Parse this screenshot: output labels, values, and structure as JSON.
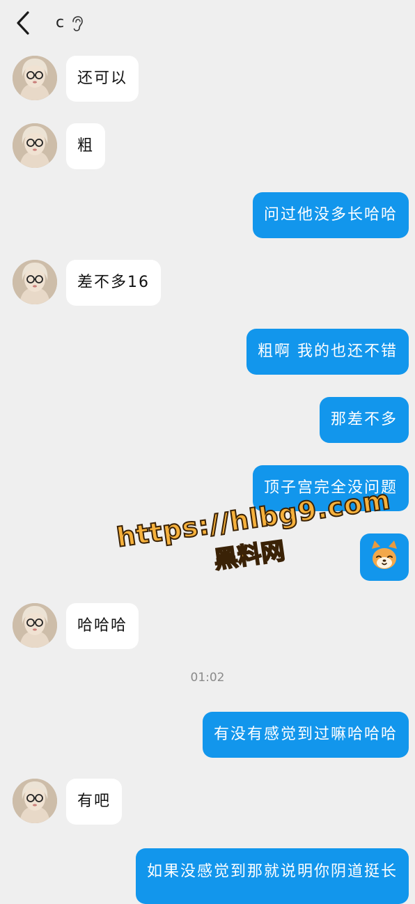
{
  "header": {
    "contact_name": "c",
    "back_icon": "chevron-left-icon",
    "ear_icon": "ear-icon"
  },
  "colors": {
    "background": "#efefef",
    "outgoing": "#1296ec",
    "incoming": "#ffffff"
  },
  "messages": [
    {
      "from": "them",
      "text": "还可以"
    },
    {
      "from": "them",
      "text": "粗"
    },
    {
      "from": "me",
      "text": "问过他没多长哈哈"
    },
    {
      "from": "them",
      "text": "差不多16"
    },
    {
      "from": "me",
      "text": "粗啊 我的也还不错"
    },
    {
      "from": "me",
      "text": "那差不多"
    },
    {
      "from": "me",
      "text": "顶子宫完全没问题"
    },
    {
      "from": "me",
      "sticker": "shiba-dog-emoji"
    },
    {
      "from": "them",
      "text": "哈哈哈"
    },
    {
      "from": "me",
      "text": "有没有感觉到过嘛哈哈哈"
    },
    {
      "from": "them",
      "text": "有吧"
    },
    {
      "from": "me",
      "text": "如果没感觉到那就说明你阴道挺长"
    }
  ],
  "timestamp": "01:02",
  "watermark": {
    "line1": "https://hlbg9.com",
    "line2": "黑料网"
  }
}
